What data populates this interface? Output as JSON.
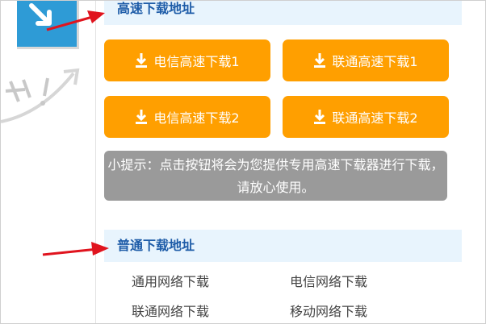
{
  "fast_download": {
    "title": "高速下载地址",
    "buttons": [
      {
        "label": "电信高速下载1"
      },
      {
        "label": "联通高速下载1"
      },
      {
        "label": "电信高速下载2"
      },
      {
        "label": "联通高速下载2"
      }
    ],
    "tip": "小提示：点击按钮将会为您提供专用高速下载器进行下载，请放心使用。"
  },
  "normal_download": {
    "title": "普通下载地址",
    "links": [
      {
        "label": "通用网络下载"
      },
      {
        "label": "电信网络下载"
      },
      {
        "label": "联通网络下载"
      },
      {
        "label": "移动网络下载"
      }
    ]
  },
  "colors": {
    "button_orange": "#ff9f00",
    "header_blue": "#1e5ca8",
    "header_bg": "#e8f4fd",
    "tip_gray": "#9a9a9a",
    "annotation_red": "#e0141e"
  }
}
